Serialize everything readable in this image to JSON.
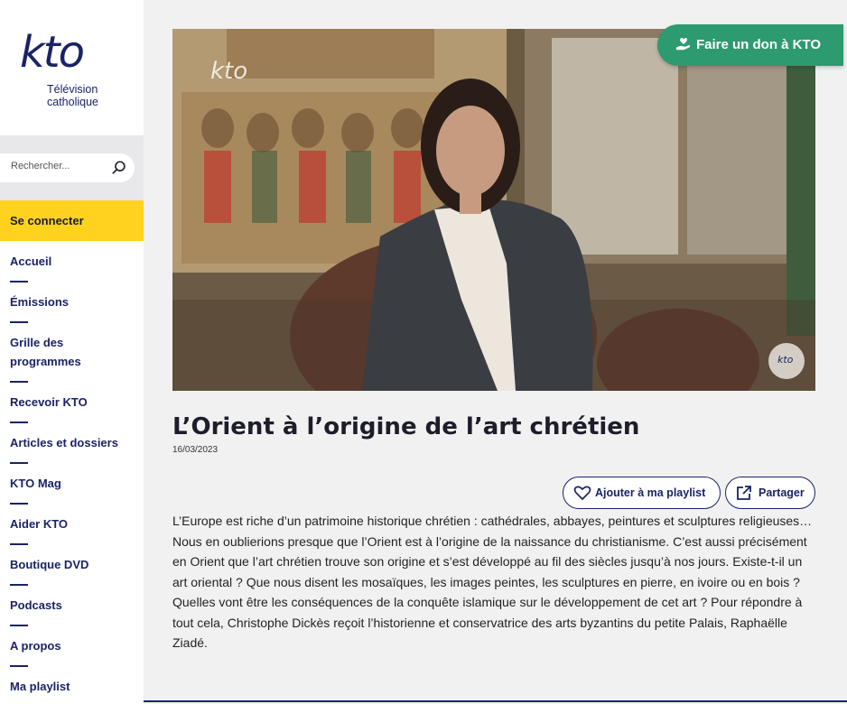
{
  "brand": {
    "logo_text": "kto",
    "tagline_line1": "Télévision",
    "tagline_line2": "catholique"
  },
  "search": {
    "placeholder": "Rechercher..."
  },
  "auth": {
    "login_label": "Se connecter"
  },
  "nav": {
    "items": [
      {
        "label": "Accueil"
      },
      {
        "label": "Émissions"
      },
      {
        "label": "Grille des programmes"
      },
      {
        "label": "Recevoir KTO"
      },
      {
        "label": "Articles et dossiers"
      },
      {
        "label": "KTO Mag"
      },
      {
        "label": "Aider KTO"
      },
      {
        "label": "Boutique DVD"
      },
      {
        "label": "Podcasts"
      },
      {
        "label": "A propos"
      },
      {
        "label": "Ma playlist"
      }
    ]
  },
  "donate": {
    "label": "Faire un don à KTO"
  },
  "video": {
    "watermark": "kto",
    "corner_badge": "kto"
  },
  "article": {
    "title": "L’Orient à l’origine de l’art chrétien",
    "date": "16/03/2023",
    "playlist_label": "Ajouter à ma playlist",
    "share_label": "Partager",
    "description": "L’Europe est riche d’un patrimoine historique chrétien : cathédrales, abbayes, peintures et sculptures religieuses… Nous en oublierions presque que l’Orient est à l’origine de la naissance du christianisme. C’est aussi précisément en Orient que l’art chrétien trouve son origine et s’est développé au fil des siècles jusqu’à nos jours. Existe-t-il un art oriental ? Que nous disent les mosaïques, les images peintes, les sculptures en pierre, en ivoire ou en bois ? Quelles vont être les conséquences de la conquête islamique sur le développement de cet art ? Pour répondre à tout cela, Christophe Dickès reçoit l’historienne et conservatrice des arts byzantins du petite Palais, Raphaëlle Ziadé."
  },
  "colors": {
    "brand_navy": "#1b2366",
    "login_yellow": "#ffd21f",
    "donate_green": "#2e9a6f",
    "page_bg": "#f1f1f2"
  }
}
